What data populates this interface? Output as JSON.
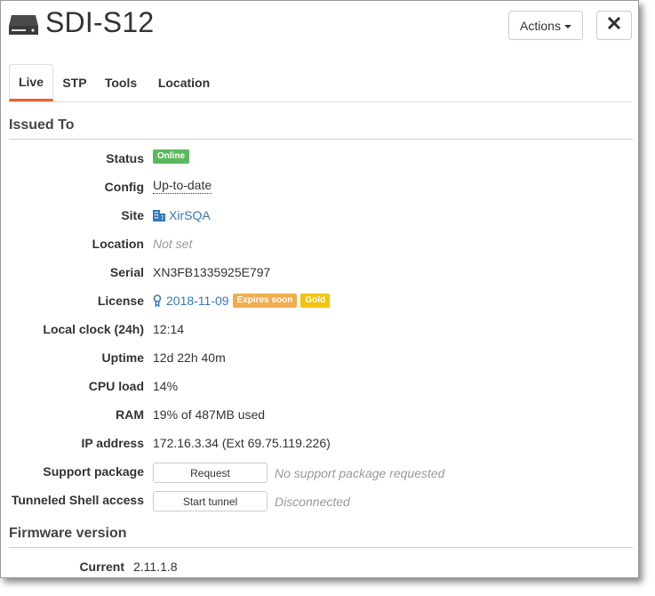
{
  "header": {
    "title": "SDI-S12",
    "actions_label": "Actions",
    "close_icon": "close-icon"
  },
  "tabs": [
    {
      "label": "Live",
      "active": true
    },
    {
      "label": "STP",
      "active": false
    },
    {
      "label": "Tools",
      "active": false
    },
    {
      "label": "Location",
      "active": false
    }
  ],
  "issued_to": {
    "section_title": "Issued To",
    "status": {
      "label": "Status",
      "badge": "Online"
    },
    "config": {
      "label": "Config",
      "value": "Up-to-date"
    },
    "site": {
      "label": "Site",
      "value": "XirSQA",
      "icon": "building-icon"
    },
    "location": {
      "label": "Location",
      "value": "Not set"
    },
    "serial": {
      "label": "Serial",
      "value": "XN3FB1335925E797"
    },
    "license": {
      "label": "License",
      "value": "2018-11-09",
      "icon": "license-icon",
      "badge_expires": "Expires soon",
      "badge_tier": "Gold"
    },
    "local_clock": {
      "label": "Local clock (24h)",
      "value": "12:14"
    },
    "uptime": {
      "label": "Uptime",
      "value": "12d 22h 40m"
    },
    "cpu_load": {
      "label": "CPU load",
      "value": "14%"
    },
    "ram": {
      "label": "RAM",
      "value": "19% of 487MB used"
    },
    "ip_address": {
      "label": "IP address",
      "value": "172.16.3.34 (Ext 69.75.119.226)"
    },
    "support_package": {
      "label": "Support package",
      "button": "Request",
      "note": "No support package requested"
    },
    "tunneled_shell": {
      "label": "Tunneled Shell access",
      "button": "Start tunnel",
      "note": "Disconnected"
    }
  },
  "firmware": {
    "section_title": "Firmware version",
    "current": {
      "label": "Current",
      "value": "2.11.1.8"
    }
  },
  "colors": {
    "accent_tab": "#e6632f",
    "online": "#5cb85c",
    "expires": "#f0ad4e",
    "gold": "#f1c40f",
    "link": "#337ab7"
  }
}
